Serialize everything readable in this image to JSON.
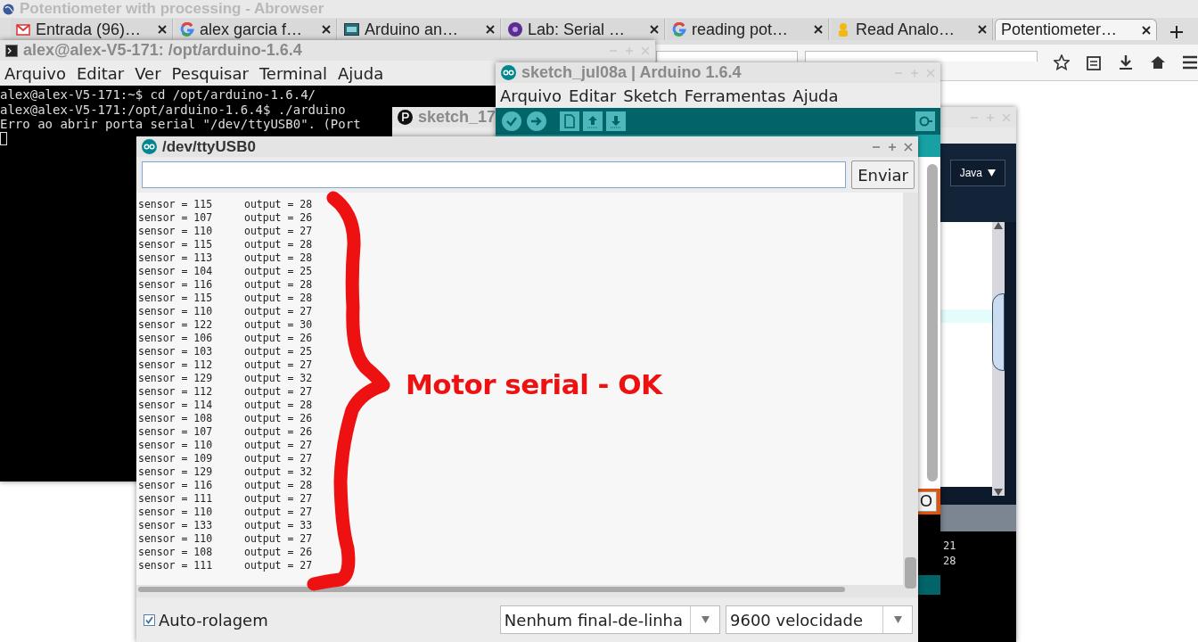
{
  "browser": {
    "title": "Potentiometer with processing - Abrowser",
    "tabs": [
      {
        "label": "Entrada (96)…",
        "kind": "mail",
        "selected": false
      },
      {
        "label": "alex garcia f…",
        "kind": "ring",
        "selected": false
      },
      {
        "label": "Arduino an…",
        "kind": "board",
        "selected": false
      },
      {
        "label": "Lab: Serial …",
        "kind": "disc",
        "selected": false
      },
      {
        "label": "reading pot…",
        "kind": "ring",
        "selected": false
      },
      {
        "label": "Read Analo…",
        "kind": "figure",
        "selected": false
      },
      {
        "label": "Potentiometer…",
        "kind": "none",
        "selected": true
      }
    ]
  },
  "terminal": {
    "title": "alex@alex-V5-171: /opt/arduino-1.6.4",
    "menu": [
      "Arquivo",
      "Editar",
      "Ver",
      "Pesquisar",
      "Terminal",
      "Ajuda"
    ],
    "lines": [
      "alex@alex-V5-171:~$ cd /opt/arduino-1.6.4/",
      "alex@alex-V5-171:/opt/arduino-1.6.4$ ./arduino",
      "Erro ao abrir porta serial \"/dev/ttyUSB0\". (Port"
    ]
  },
  "processing": {
    "title": "sketch_17",
    "mode": "Java",
    "console_lines": [
      "21",
      "28"
    ]
  },
  "arduino": {
    "title": "sketch_jul08a | Arduino 1.6.4",
    "menu": [
      "Arquivo",
      "Editar",
      "Sketch",
      "Ferramentas",
      "Ajuda"
    ],
    "status_text": "O"
  },
  "serial_monitor": {
    "title": "/dev/ttyUSB0",
    "send_button": "Enviar",
    "lines": [
      {
        "sensor": "sensor = 115",
        "output": "output = 28"
      },
      {
        "sensor": "sensor = 107",
        "output": "output = 26"
      },
      {
        "sensor": "sensor = 110",
        "output": "output = 27"
      },
      {
        "sensor": "sensor = 115",
        "output": "output = 28"
      },
      {
        "sensor": "sensor = 113",
        "output": "output = 28"
      },
      {
        "sensor": "sensor = 104",
        "output": "output = 25"
      },
      {
        "sensor": "sensor = 116",
        "output": "output = 28"
      },
      {
        "sensor": "sensor = 115",
        "output": "output = 28"
      },
      {
        "sensor": "sensor = 110",
        "output": "output = 27"
      },
      {
        "sensor": "sensor = 122",
        "output": "output = 30"
      },
      {
        "sensor": "sensor = 106",
        "output": "output = 26"
      },
      {
        "sensor": "sensor = 103",
        "output": "output = 25"
      },
      {
        "sensor": "sensor = 112",
        "output": "output = 27"
      },
      {
        "sensor": "sensor = 129",
        "output": "output = 32"
      },
      {
        "sensor": "sensor = 112",
        "output": "output = 27"
      },
      {
        "sensor": "sensor = 114",
        "output": "output = 28"
      },
      {
        "sensor": "sensor = 108",
        "output": "output = 26"
      },
      {
        "sensor": "sensor = 107",
        "output": "output = 26"
      },
      {
        "sensor": "sensor = 110",
        "output": "output = 27"
      },
      {
        "sensor": "sensor = 109",
        "output": "output = 27"
      },
      {
        "sensor": "sensor = 129",
        "output": "output = 32"
      },
      {
        "sensor": "sensor = 116",
        "output": "output = 28"
      },
      {
        "sensor": "sensor = 111",
        "output": "output = 27"
      },
      {
        "sensor": "sensor = 110",
        "output": "output = 27"
      },
      {
        "sensor": "sensor = 133",
        "output": "output = 33"
      },
      {
        "sensor": "sensor = 110",
        "output": "output = 27"
      },
      {
        "sensor": "sensor = 108",
        "output": "output = 26"
      },
      {
        "sensor": "sensor = 111",
        "output": "output = 27"
      }
    ],
    "autoscroll": {
      "label": "Auto-rolagem",
      "checked": true
    },
    "line_ending": "Nenhum final-de-linha",
    "baud_rate": "9600 velocidade"
  },
  "annotation": {
    "text": "Motor serial - OK"
  }
}
